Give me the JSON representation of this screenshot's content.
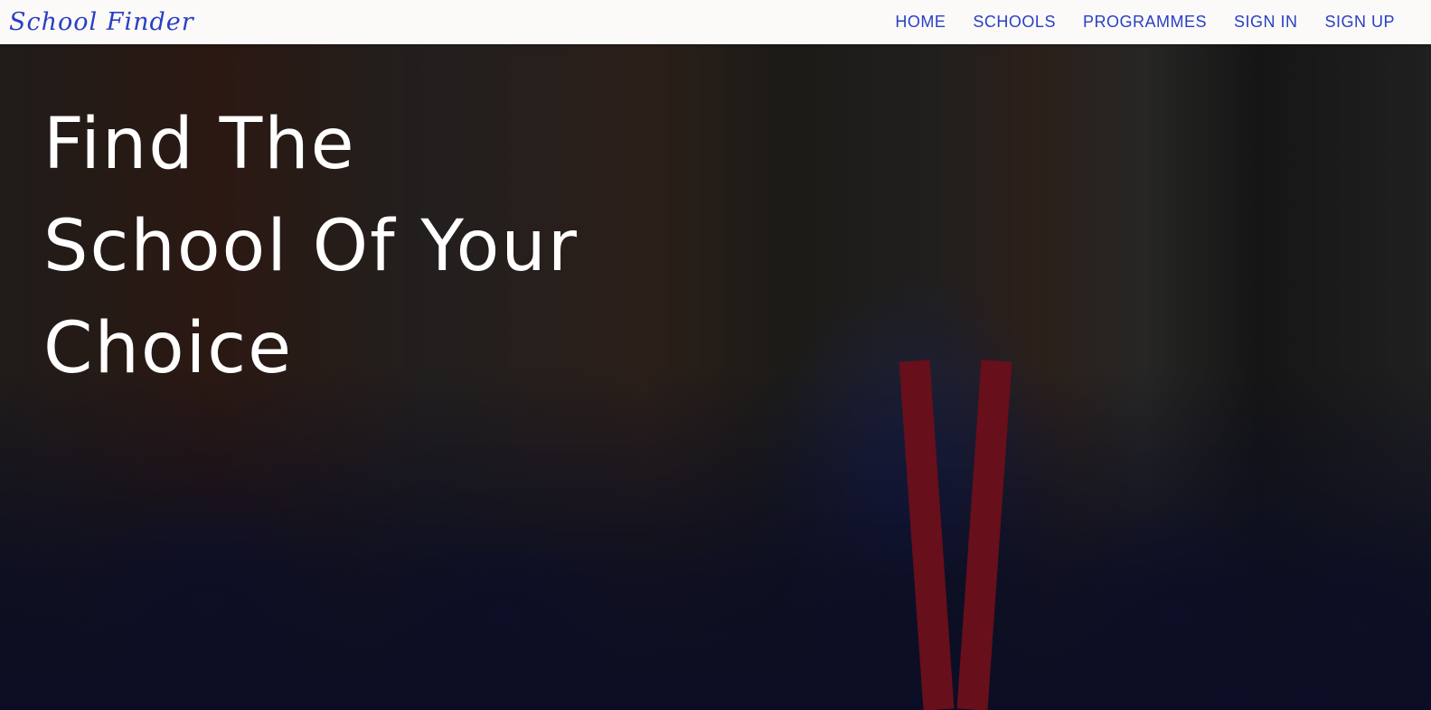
{
  "header": {
    "logo": "School Finder",
    "nav": [
      {
        "label": "HOME"
      },
      {
        "label": "SCHOOLS"
      },
      {
        "label": "PROGRAMMES"
      },
      {
        "label": "SIGN IN"
      },
      {
        "label": "SIGN UP"
      }
    ]
  },
  "hero": {
    "title_lines": [
      "Find The",
      "School Of Your",
      "Choice"
    ]
  },
  "colors": {
    "accent": "#2a3fc4",
    "nav_bg": "#fbfaf8"
  }
}
